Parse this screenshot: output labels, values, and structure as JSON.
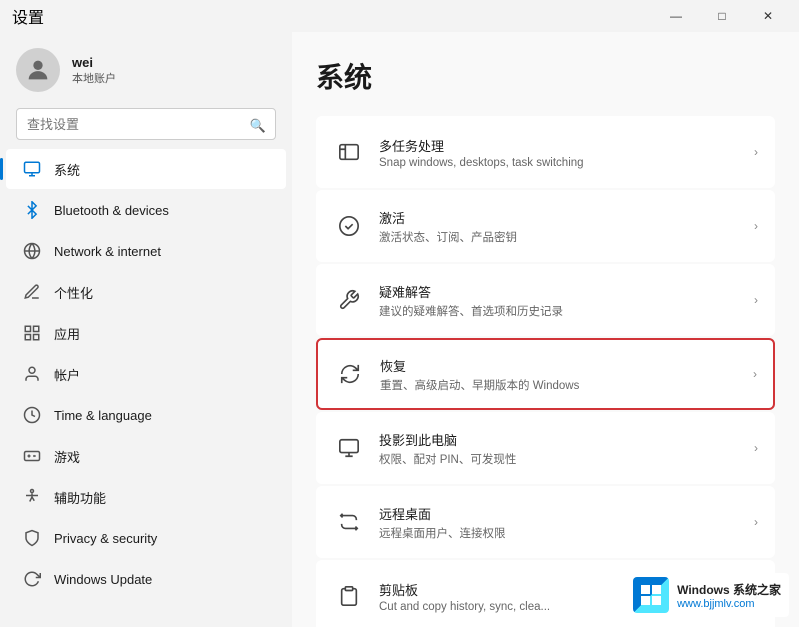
{
  "titleBar": {
    "title": "设置",
    "controls": {
      "minimize": "—",
      "maximize": "□",
      "close": "✕"
    }
  },
  "sidebar": {
    "user": {
      "name": "wei",
      "role": "本地账户"
    },
    "search": {
      "placeholder": "查找设置",
      "value": ""
    },
    "navItems": [
      {
        "id": "system",
        "label": "系统",
        "icon": "🖥",
        "active": true
      },
      {
        "id": "bluetooth",
        "label": "Bluetooth & devices",
        "icon": "B",
        "active": false
      },
      {
        "id": "network",
        "label": "Network & internet",
        "icon": "N",
        "active": false
      },
      {
        "id": "personalization",
        "label": "个性化",
        "icon": "🖊",
        "active": false
      },
      {
        "id": "apps",
        "label": "应用",
        "icon": "A",
        "active": false
      },
      {
        "id": "accounts",
        "label": "帐户",
        "icon": "👤",
        "active": false
      },
      {
        "id": "time",
        "label": "Time & language",
        "icon": "⏰",
        "active": false
      },
      {
        "id": "gaming",
        "label": "游戏",
        "icon": "🎮",
        "active": false
      },
      {
        "id": "accessibility",
        "label": "辅助功能",
        "icon": "♿",
        "active": false
      },
      {
        "id": "privacy",
        "label": "Privacy & security",
        "icon": "🔒",
        "active": false
      },
      {
        "id": "update",
        "label": "Windows Update",
        "icon": "↻",
        "active": false
      }
    ]
  },
  "content": {
    "pageTitle": "系统",
    "settingItems": [
      {
        "id": "multitasking",
        "title": "多任务处理",
        "desc": "Snap windows, desktops, task switching",
        "iconType": "window"
      },
      {
        "id": "activation",
        "title": "激活",
        "desc": "激活状态、订阅、产品密钥",
        "iconType": "check-circle"
      },
      {
        "id": "troubleshoot",
        "title": "疑难解答",
        "desc": "建议的疑难解答、首选项和历史记录",
        "iconType": "wrench"
      },
      {
        "id": "recovery",
        "title": "恢复",
        "desc": "重置、高级启动、早期版本的 Windows",
        "iconType": "refresh",
        "highlighted": true
      },
      {
        "id": "projection",
        "title": "投影到此电脑",
        "desc": "权限、配对 PIN、可发现性",
        "iconType": "monitor"
      },
      {
        "id": "remote",
        "title": "远程桌面",
        "desc": "远程桌面用户、连接权限",
        "iconType": "remote"
      },
      {
        "id": "clipboard",
        "title": "剪贴板",
        "desc": "Cut and copy history, sync, clea...",
        "iconType": "clipboard"
      }
    ]
  },
  "watermark": {
    "line1": "Windows 系统之家",
    "line2": "www.bjjmlv.com"
  }
}
